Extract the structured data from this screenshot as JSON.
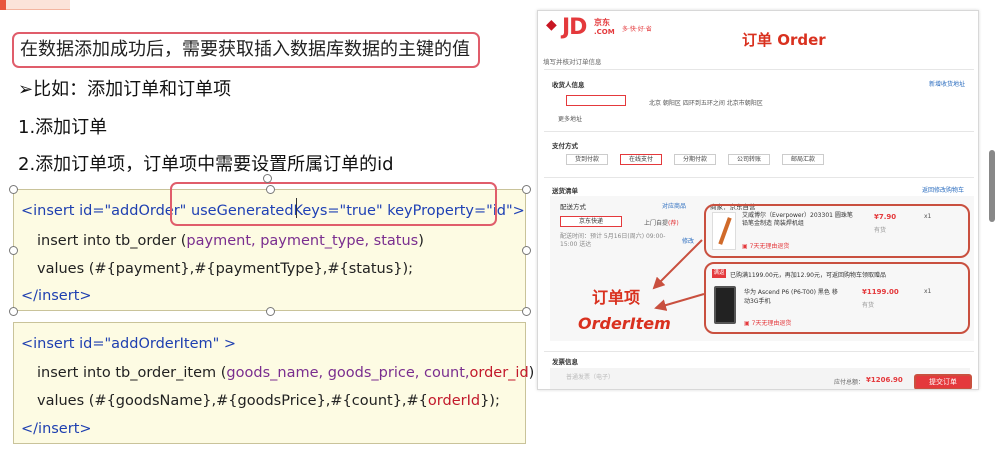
{
  "slide": {
    "headline": "在数据添加成功后，需要获取插入数据库数据的主键的值",
    "lines": [
      "➢比如：添加订单和订单项",
      "1.添加订单",
      "2.添加订单项，订单项中需要设置所属订单的id"
    ]
  },
  "code1": {
    "l1a": "<insert id=\"addOrder\" ",
    "l1b": "useGeneratedKeys=\"true\" keyProperty=\"id\">",
    "l2a": "insert into tb_order (",
    "l2b": "payment, payment_type, status",
    "l2c": ")",
    "l3": "values (#{payment},#{paymentType},#{status});",
    "l4": "</insert>"
  },
  "code2": {
    "l1": "<insert id=\"addOrderItem\" >",
    "l2a": "insert into tb_order_item (",
    "l2b": "goods_name, goods_price, count,",
    "l2c": "order_id",
    "l2d": ")",
    "l3a": "values (#{goodsName},#{goodsPrice},#{count},#{",
    "l3b": "orderId",
    "l3c": "});",
    "l4": "</insert>"
  },
  "jd": {
    "logo": "JD",
    "logo_cn": "京东",
    "logo_com": ".COM",
    "slogan": "多·快·好·省",
    "section_fill": "填写并核对订单信息",
    "receiver_title": "收货人信息",
    "new_address": "新增收货地址",
    "address": "北京 朝阳区 四环到五环之间 北京市朝阳区",
    "more_address": "更多地址",
    "payment_title": "支付方式",
    "payment_methods": [
      "货到付款",
      "在线支付",
      "分期付款",
      "公司转账",
      "邮局汇款"
    ],
    "shipping_title": "送货清单",
    "back_cart": "返回修改购物车",
    "delivery_label": "配送方式",
    "goods_in_stock": "对应商品",
    "merchant": "商家：京东自营",
    "express": "京东快递",
    "pickup": "上门自提",
    "pickup_badge": "(荐)",
    "delivery_time": "配送时间：预计 5月16日(周六) 09:00-15:00 送达",
    "modify": "修改",
    "item1_name": "艾威博尔（Everpower）203301 圆珠笔铅笔金制造 简装焊机组",
    "item1_price": "¥7.90",
    "item1_qty": "x1",
    "item1_stock": "有货",
    "item1_service": "7天无理由退货",
    "promo_tag": "满返",
    "promo_text": "已购满1199.00元，再加12.90元，可返回购物车领取赠品",
    "item2_name": "华为 Ascend P6 (P6-T00) 黑色 移动3G手机",
    "item2_price": "¥1199.00",
    "item2_qty": "x1",
    "item2_stock": "有货",
    "item2_service": "7天无理由退货",
    "invoice_title": "发票信息",
    "invoice_sub": "普通发票（电子）",
    "total_label": "应付总额：",
    "total_value": "¥1206.90",
    "submit": "提交订单",
    "ann_order": "订单 Order",
    "ann_item_cn": "订单项",
    "ann_item_en": "OrderItem"
  },
  "colors": {
    "accent_red": "#e4393c",
    "highlight_border": "#e05d6b",
    "code_bg": "#fdfbe3",
    "annotation": "#d9311f"
  }
}
